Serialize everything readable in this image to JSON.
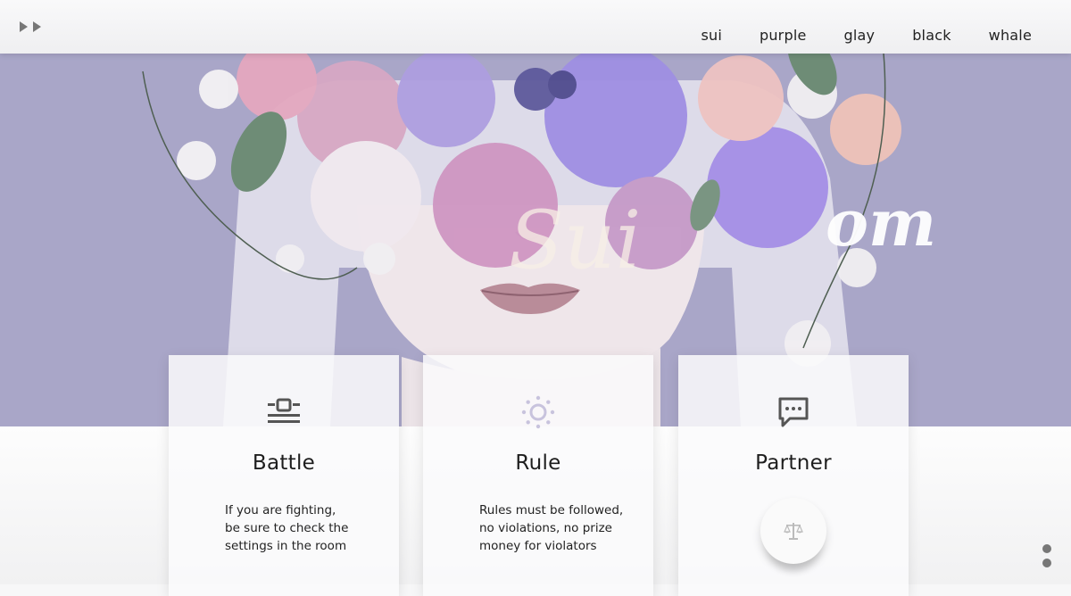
{
  "nav": {
    "items": [
      {
        "label": "sui"
      },
      {
        "label": "purple"
      },
      {
        "label": "glay"
      },
      {
        "label": "black"
      },
      {
        "label": "whale"
      }
    ]
  },
  "hero": {
    "signature": "Sui",
    "watermark": "om"
  },
  "cards": [
    {
      "title": "Battle",
      "icon": "battle-icon",
      "desc_lines": [
        "If you are fighting,",
        "be sure to check the",
        "settings in the room"
      ]
    },
    {
      "title": "Rule",
      "icon": "sun-icon",
      "desc_lines": [
        "Rules must be followed,",
        "no violations, no prize",
        "money for violators"
      ]
    },
    {
      "title": "Partner",
      "icon": "chat-bubble-icon",
      "button_icon": "scales-icon"
    }
  ],
  "colors": {
    "hero_background": "#a9a6c8",
    "icon_gray": "#555555",
    "icon_lavender": "#c8c3dd"
  }
}
